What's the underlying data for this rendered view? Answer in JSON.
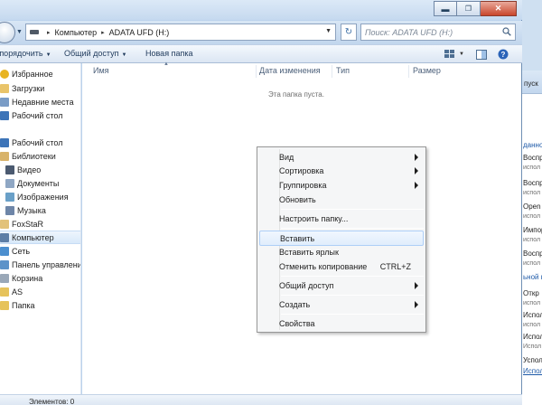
{
  "window": {
    "address": {
      "crumbs": [
        "Компьютер",
        "ADATA UFD (H:)"
      ]
    },
    "search": {
      "placeholder": "Поиск: ADATA UFD (H:)"
    }
  },
  "toolbar": {
    "organize_label": "Упорядочить",
    "share_label": "Общий доступ",
    "new_folder_label": "Новая папка"
  },
  "navpane": {
    "items": [
      {
        "label": "Избранное",
        "icon": "star-icon"
      },
      {
        "label": "Загрузки",
        "icon": "downloads-folder-icon"
      },
      {
        "label": "Недавние места",
        "icon": "recent-places-icon"
      },
      {
        "label": "Рабочий стол",
        "icon": "desktop-icon"
      },
      {
        "label": "Рабочий стол",
        "icon": "desktop-icon"
      },
      {
        "label": "Библиотеки",
        "icon": "libraries-icon"
      },
      {
        "label": "Видео",
        "icon": "video-icon"
      },
      {
        "label": "Документы",
        "icon": "documents-icon"
      },
      {
        "label": "Изображения",
        "icon": "pictures-icon"
      },
      {
        "label": "Музыка",
        "icon": "music-icon"
      },
      {
        "label": "FoxStaR",
        "icon": "user-folder-icon"
      },
      {
        "label": "Компьютер",
        "icon": "computer-icon",
        "selected": true
      },
      {
        "label": "Сеть",
        "icon": "network-icon"
      },
      {
        "label": "Панель управления",
        "icon": "control-panel-icon"
      },
      {
        "label": "Корзина",
        "icon": "recycle-bin-icon"
      },
      {
        "label": "AS",
        "icon": "folder-icon"
      },
      {
        "label": "Папка",
        "icon": "folder-icon"
      }
    ]
  },
  "columns": {
    "name": "Имя",
    "date": "Дата изменения",
    "type": "Тип",
    "size": "Размер"
  },
  "content": {
    "empty_text": "Эта папка пуста."
  },
  "status": {
    "text": "Элементов: 0"
  },
  "context_menu": {
    "items": [
      {
        "label": "Вид",
        "submenu": true
      },
      {
        "label": "Сортировка",
        "submenu": true
      },
      {
        "label": "Группировка",
        "submenu": true
      },
      {
        "label": "Обновить"
      },
      {
        "label": "Настроить папку..."
      },
      {
        "label": "Вставить",
        "highlighted": true
      },
      {
        "label": "Вставить ярлык"
      },
      {
        "label": "Отменить копирование",
        "shortcut": "CTRL+Z"
      },
      {
        "label": "Общий доступ",
        "submenu": true
      },
      {
        "label": "Создать",
        "submenu": true
      },
      {
        "label": "Свойства"
      }
    ]
  },
  "background_window": {
    "header": "пуск",
    "lines": [
      {
        "text": "данно",
        "style": "blue"
      },
      {
        "text": "Воспр",
        "style": ""
      },
      {
        "text": "испол",
        "style": "sub"
      },
      {
        "text": "Воспр",
        "style": ""
      },
      {
        "text": "испол",
        "style": "sub"
      },
      {
        "text": "Open",
        "style": ""
      },
      {
        "text": "испол",
        "style": "sub"
      },
      {
        "text": "Импор",
        "style": ""
      },
      {
        "text": "испол",
        "style": "sub"
      },
      {
        "text": "Воспр",
        "style": ""
      },
      {
        "text": "испол",
        "style": "sub"
      },
      {
        "text": "ьной но",
        "style": "blue"
      },
      {
        "text": "Откр",
        "style": ""
      },
      {
        "text": "испол",
        "style": "sub"
      },
      {
        "text": "Испол",
        "style": ""
      },
      {
        "text": "испол",
        "style": "sub"
      },
      {
        "text": "Испол",
        "style": ""
      },
      {
        "text": "Испол",
        "style": "sub"
      },
      {
        "text": "Успол",
        "style": ""
      },
      {
        "text": "Исполь",
        "style": "link"
      }
    ]
  }
}
